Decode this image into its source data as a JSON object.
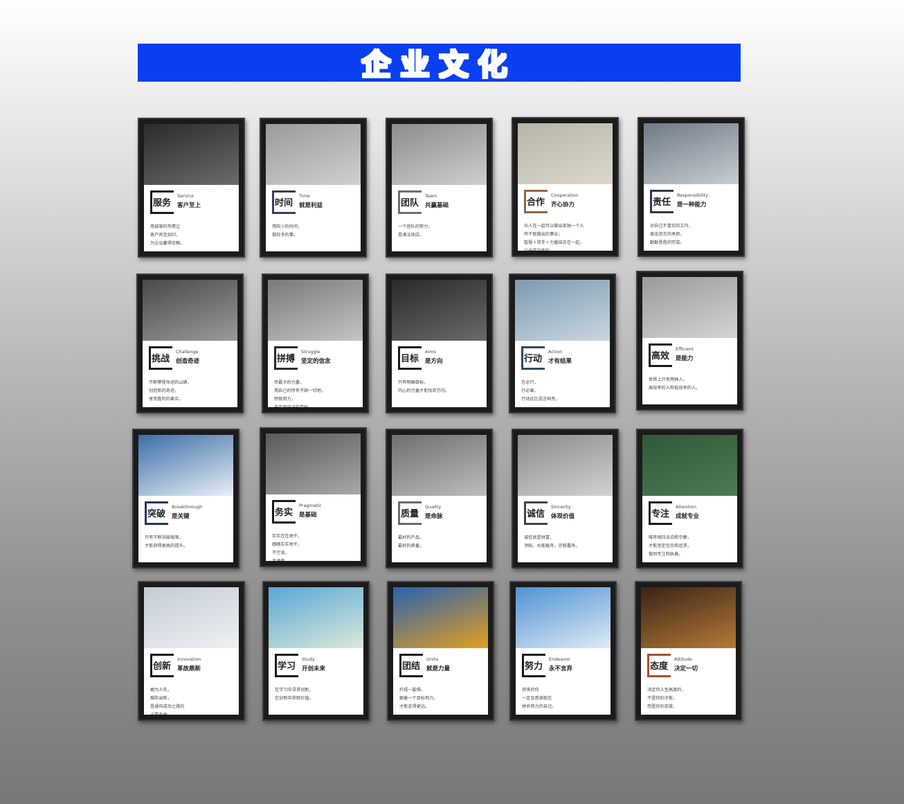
{
  "banner": {
    "title": "企业文化",
    "bg": "#0a3ff0"
  },
  "cards": [
    {
      "zh_title": "服务",
      "en": "Service",
      "slogan": "客户至上",
      "lines": [
        "用诚挚的热情让",
        "客户宾至如归，",
        "为企业赢得信赖。"
      ],
      "accent": "#1a1a1a",
      "photo": [
        "#2b2b2b",
        "#6b6b6b"
      ]
    },
    {
      "zh_title": "时间",
      "en": "Time",
      "slogan": "就是利益",
      "lines": [
        "用较少的时间，",
        "做较多的事。"
      ],
      "accent": "#3a3f55",
      "photo": [
        "#9a9a9a",
        "#d0d0d0"
      ]
    },
    {
      "zh_title": "团队",
      "en": "Team",
      "slogan": "共赢基础",
      "lines": [
        "一个团队的努力，",
        "是满法效应。"
      ],
      "accent": "#6f6f6f",
      "photo": [
        "#8c8c8c",
        "#cfcfcf"
      ]
    },
    {
      "zh_title": "合作",
      "en": "Cooperation",
      "slogan": "齐心协力",
      "lines": [
        "众人在一起可以做出单独一个人",
        "所不能做出的事业；",
        "智慧＋双手＋力量结合在一起，",
        "几乎是万能的。"
      ],
      "accent": "#8a6a45",
      "photo": [
        "#b8b4a8",
        "#dcd8cc"
      ]
    },
    {
      "zh_title": "责任",
      "en": "Responsibility",
      "slogan": "是一种能力",
      "lines": [
        "对自己不喜欢的工作，",
        "毫无怨言的承担，",
        "勤勤恳恳的完成。"
      ],
      "accent": "#2f3a4d",
      "photo": [
        "#6f7a86",
        "#c8cdd3"
      ]
    },
    {
      "zh_title": "挑战",
      "en": "Challenge",
      "slogan": "创造奇迹",
      "lines": [
        "不断攀登命运的山峰，",
        "创造新的奇迹，",
        "享受胜利的果实。"
      ],
      "accent": "#1a1a1a",
      "photo": [
        "#4a4a4a",
        "#9a9a9a"
      ]
    },
    {
      "zh_title": "拼搏",
      "en": "Struggle",
      "slogan": "坚定的信念",
      "lines": [
        "尽最大的力量，",
        "用自己的所有不顾一切地，",
        "积极努力，",
        "去实现自己的目标。"
      ],
      "accent": "#2a2a2a",
      "photo": [
        "#7a7a7a",
        "#c4c4c4"
      ]
    },
    {
      "zh_title": "目标",
      "en": "Aims",
      "slogan": "是方向",
      "lines": [
        "只有明确目标，",
        "内心的力量才能找到方向。"
      ],
      "accent": "#1a1a1a",
      "photo": [
        "#2a2a2a",
        "#6a6a6a"
      ]
    },
    {
      "zh_title": "行动",
      "en": "Action",
      "slogan": "才有结果",
      "lines": [
        "言必行，",
        "行必果，",
        "行动远比语言响亮。"
      ],
      "accent": "#34495e",
      "photo": [
        "#7d9ab0",
        "#c9d7e0"
      ]
    },
    {
      "zh_title": "高效",
      "en": "Efficient",
      "slogan": "是能力",
      "lines": [
        "世界上只有两种人，",
        "高效率的人和低效率的人。"
      ],
      "accent": "#1a1a1a",
      "photo": [
        "#9a9a9a",
        "#d4d4d4"
      ]
    },
    {
      "zh_title": "突破",
      "en": "Breakthrough",
      "slogan": "是关键",
      "lines": [
        "只有不断突破极限，",
        "才能获得更高的提升。"
      ],
      "accent": "#1e3a5f",
      "photo": [
        "#3b6fa8",
        "#e8eef5"
      ]
    },
    {
      "zh_title": "务实",
      "en": "Pragmatic",
      "slogan": "是基础",
      "lines": [
        "实实在在地干，",
        "踏踏实实地干，",
        "不空谈，",
        "不虚夸。"
      ],
      "accent": "#1a1a1a",
      "photo": [
        "#5a5a5a",
        "#a8a8a8"
      ]
    },
    {
      "zh_title": "质量",
      "en": "Quality",
      "slogan": "是命脉",
      "lines": [
        "最好的产品，",
        "最好的质量。"
      ],
      "accent": "#6a6a6a",
      "photo": [
        "#6f6f6f",
        "#bdbdbd"
      ]
    },
    {
      "zh_title": "诚信",
      "en": "Sincerity",
      "slogan": "体现价值",
      "lines": [
        "诚信就是财富，",
        "须知，水能载舟，亦能覆舟。"
      ],
      "accent": "#444444",
      "photo": [
        "#8a8a8a",
        "#d2d2d2"
      ]
    },
    {
      "zh_title": "专注",
      "en": "Attention",
      "slogan": "成就专业",
      "lines": [
        "唯有保持淡泊和宁静，",
        "才能坚定信念和追求，",
        "做到专注和执着。"
      ],
      "accent": "#1a1a1a",
      "photo": [
        "#2f5a3a",
        "#4f7a55"
      ]
    },
    {
      "zh_title": "创新",
      "en": "Innovation",
      "slogan": "革故鼎新",
      "lines": [
        "敢为人先，",
        "推陈出新，",
        "是通向成功之路的",
        "必要条件。"
      ],
      "accent": "#1a1a1a",
      "photo": [
        "#c4ccd4",
        "#eef1f4"
      ]
    },
    {
      "zh_title": "学习",
      "en": "Study",
      "slogan": "开创未来",
      "lines": [
        "在学习中寻求创新，",
        "在创新中获取价值。"
      ],
      "accent": "#1a1a1a",
      "photo": [
        "#5aa7d6",
        "#dbe9d9"
      ]
    },
    {
      "zh_title": "团结",
      "en": "Unite",
      "slogan": "就是力量",
      "lines": [
        "拧成一股绳，",
        "朝着一个目标努力，",
        "才能走得更远。"
      ],
      "accent": "#1a1a1a",
      "photo": [
        "#2a62b0",
        "#e0a020"
      ]
    },
    {
      "zh_title": "努力",
      "en": "Endeavor",
      "slogan": "永不言弃",
      "lines": [
        "将来的你",
        "一定会感谢现在",
        "拼命努力的自己。"
      ],
      "accent": "#1a1a1a",
      "photo": [
        "#4f93d4",
        "#dfeaf5"
      ]
    },
    {
      "zh_title": "态度",
      "en": "Attitude",
      "slogan": "决定一切",
      "lines": [
        "决定你人生高度的，",
        "不是你的才能，",
        "而是你的态度。"
      ],
      "accent": "#a0522d",
      "photo": [
        "#3a2414",
        "#b57a3a"
      ]
    }
  ]
}
